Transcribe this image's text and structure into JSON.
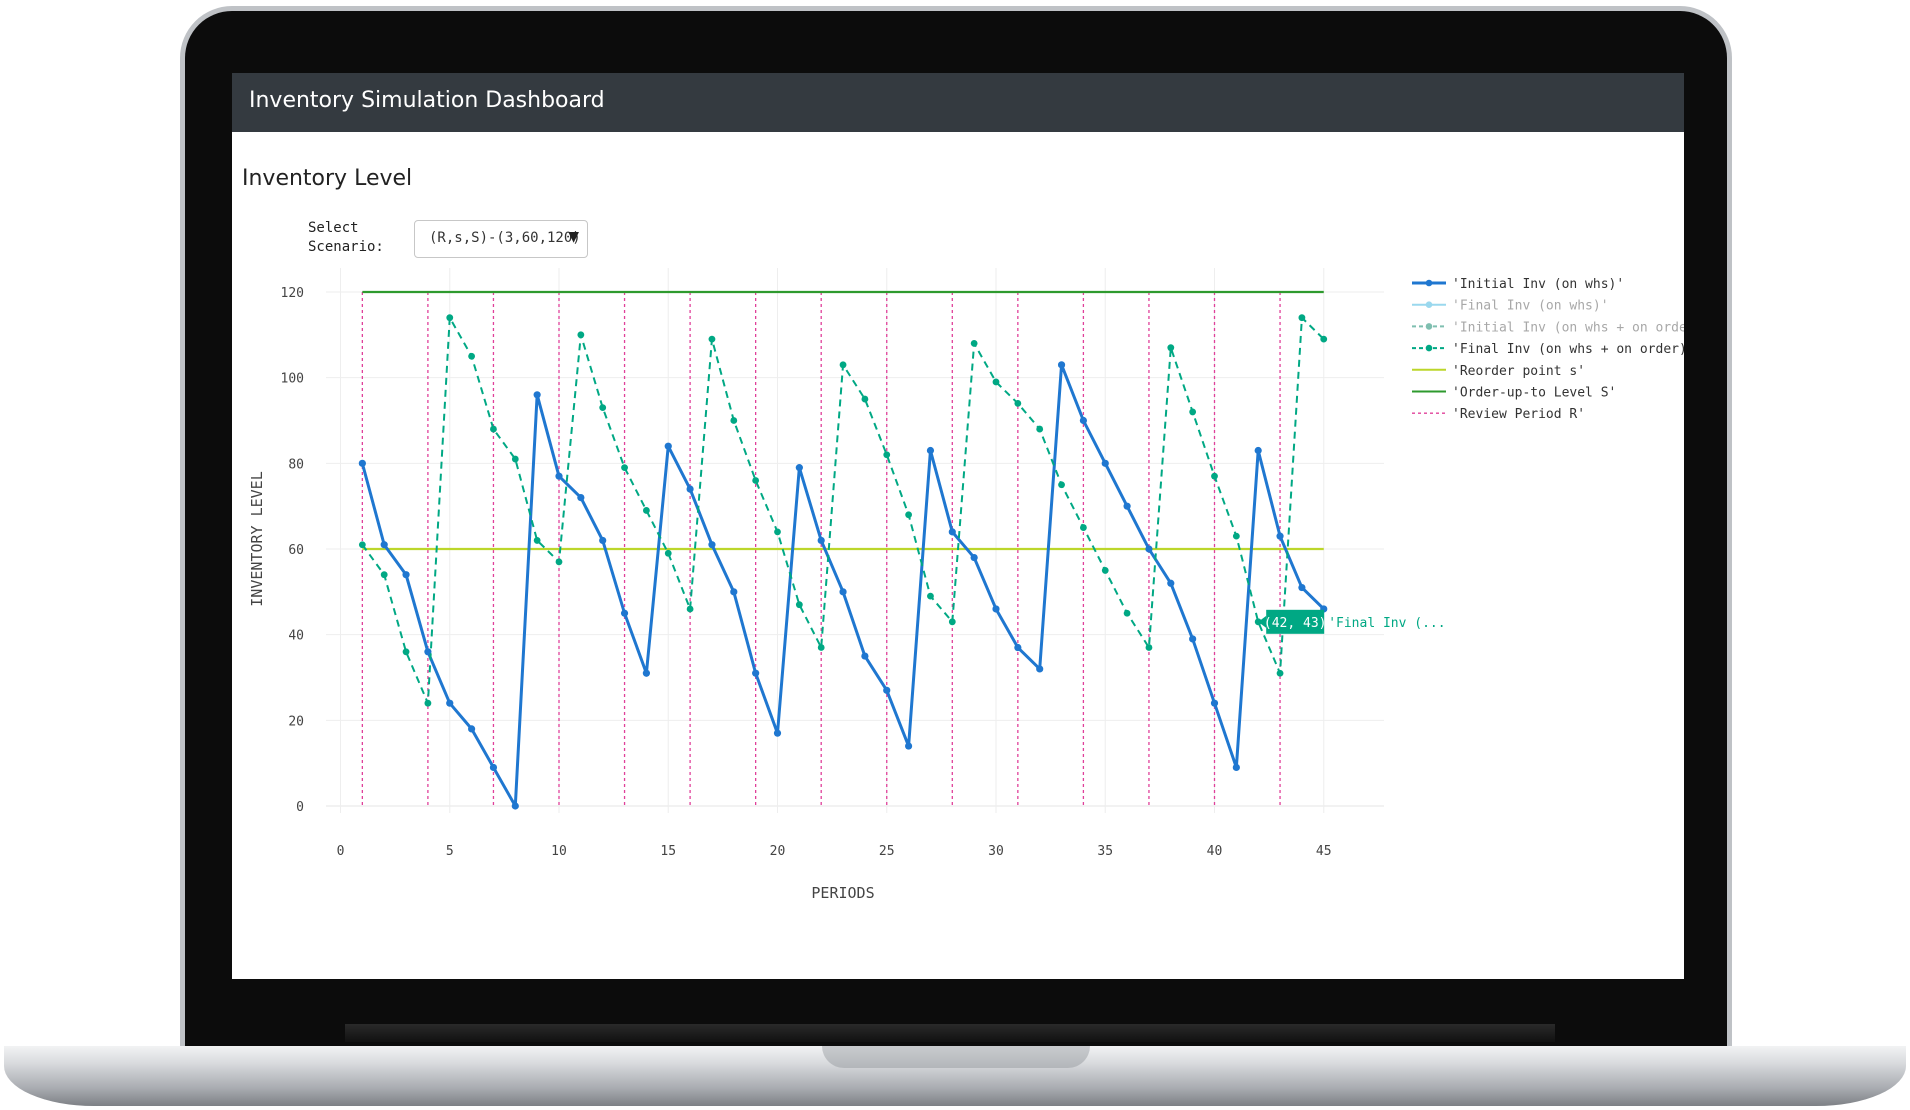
{
  "app": {
    "title": "Inventory Simulation Dashboard"
  },
  "section": {
    "title": "Inventory Level"
  },
  "scenario": {
    "label": "Select Scenario:",
    "selected": "(R,s,S)-(3,60,120)"
  },
  "tooltip": {
    "value_text": "(42, 43)",
    "series_text": "'Final Inv (..."
  },
  "chart_data": {
    "type": "line",
    "xlabel": "PERIODS",
    "ylabel": "INVENTORY LEVEL",
    "xlim": [
      -1,
      47
    ],
    "ylim": [
      -5,
      125
    ],
    "x_ticks": [
      0,
      5,
      10,
      15,
      20,
      25,
      30,
      35,
      40,
      45
    ],
    "y_ticks": [
      0,
      20,
      40,
      60,
      80,
      100,
      120
    ],
    "grid": true,
    "legend_position": "top-right",
    "series": [
      {
        "name": "'Initial Inv (on whs)'",
        "color": "#1f77d0",
        "style": "solid-markers",
        "x": [
          1,
          2,
          3,
          4,
          5,
          6,
          7,
          8,
          9,
          10,
          11,
          12,
          13,
          14,
          15,
          16,
          17,
          18,
          19,
          20,
          21,
          22,
          23,
          24,
          25,
          26,
          27,
          28,
          29,
          30,
          31,
          32,
          33,
          34,
          35,
          36,
          37,
          38,
          39,
          40,
          41,
          42,
          43,
          44,
          45
        ],
        "y": [
          80,
          61,
          54,
          36,
          24,
          18,
          9,
          0,
          96,
          77,
          72,
          62,
          45,
          31,
          84,
          74,
          61,
          50,
          31,
          17,
          79,
          62,
          50,
          35,
          27,
          14,
          83,
          64,
          58,
          46,
          37,
          32,
          103,
          90,
          80,
          70,
          60,
          52,
          39,
          24,
          9,
          83,
          63,
          51,
          46
        ]
      },
      {
        "name": "'Final Inv (on whs)'",
        "color": "#9ad8ee",
        "style": "legend-only",
        "x": [],
        "y": []
      },
      {
        "name": "'Initial Inv (on whs + on order)'",
        "color": "#7fbfb0",
        "style": "legend-only",
        "x": [],
        "y": []
      },
      {
        "name": "'Final Inv (on whs + on order)'",
        "color": "#00a884",
        "style": "dashed-markers",
        "x": [
          1,
          2,
          3,
          4,
          5,
          6,
          7,
          8,
          9,
          10,
          11,
          12,
          13,
          14,
          15,
          16,
          17,
          18,
          19,
          20,
          21,
          22,
          23,
          24,
          25,
          26,
          27,
          28,
          29,
          30,
          31,
          32,
          33,
          34,
          35,
          36,
          37,
          38,
          39,
          40,
          41,
          42,
          43,
          44,
          45
        ],
        "y": [
          61,
          54,
          36,
          24,
          114,
          105,
          88,
          81,
          62,
          57,
          110,
          93,
          79,
          69,
          59,
          46,
          109,
          90,
          76,
          64,
          47,
          37,
          103,
          95,
          82,
          68,
          49,
          43,
          108,
          99,
          94,
          88,
          75,
          65,
          55,
          45,
          37,
          107,
          92,
          77,
          63,
          43,
          31,
          114,
          109
        ]
      },
      {
        "name": "'Reorder point s'",
        "color": "#bcd62a",
        "style": "hline",
        "value": 60,
        "x_range": [
          1,
          45
        ]
      },
      {
        "name": "'Order-up-to Level S'",
        "color": "#2e9a2e",
        "style": "hline",
        "value": 120,
        "x_range": [
          1,
          45
        ]
      },
      {
        "name": "'Review Period R'",
        "color": "#e0409a",
        "style": "vlines",
        "x": [
          1,
          4,
          7,
          10,
          13,
          16,
          19,
          22,
          25,
          28,
          31,
          34,
          37,
          40,
          43
        ]
      }
    ]
  }
}
